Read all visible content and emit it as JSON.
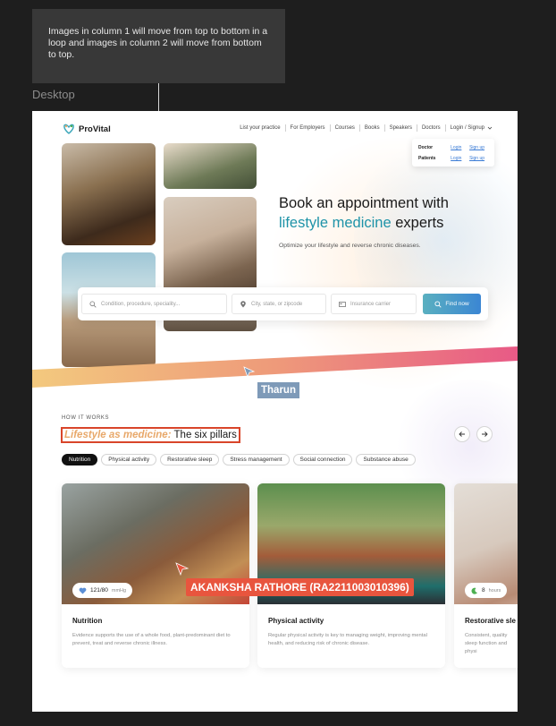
{
  "annotation": {
    "note": "Images in column 1 will move from top to bottom in a loop and images in column 2 will move from bottom to top.",
    "frame_label": "Desktop"
  },
  "nav": {
    "logo": "ProVital",
    "links": [
      "List your practice",
      "For Employers",
      "Courses",
      "Books",
      "Speakers",
      "Doctors",
      "Login / Signup"
    ]
  },
  "login_dropdown": {
    "rows": [
      {
        "role": "Doctor",
        "login": "Login",
        "signup": "Sign up"
      },
      {
        "role": "Patients",
        "login": "Login",
        "signup": "Sign up"
      }
    ]
  },
  "hero": {
    "title_line1": "Book an appointment with",
    "title_accent": "lifestyle medicine",
    "title_rest": " experts",
    "subtitle": "Optimize your lifestyle and reverse chronic diseases."
  },
  "search": {
    "condition_placeholder": "Condition, procedure, speciality...",
    "location_placeholder": "City, state, or zipcode",
    "insurance_placeholder": "Insurance carrier",
    "button": "Find now"
  },
  "cursors": {
    "tharun": "Tharun",
    "akanksha": "AKANKSHA RATHORE (RA2211003010396)"
  },
  "how_it_works": {
    "label": "HOW IT WORKS",
    "title_accent": "Lifestyle as medicine:",
    "title_rest": " The six pillars",
    "chips": [
      "Nutrition",
      "Physical activity",
      "Restorative sleep",
      "Stress management",
      "Social connection",
      "Substance abuse"
    ],
    "active_chip": "Nutrition"
  },
  "cards": [
    {
      "title": "Nutrition",
      "badge_value": "121/80",
      "badge_unit": "mmHg",
      "text": "Evidence supports the use of a whole food, plant-predominant diet to prevent, treat and reverse chronic illness."
    },
    {
      "title": "Physical activity",
      "text": "Regular physical activity is key to managing weight, improving mental health, and reducing risk of chronic disease."
    },
    {
      "title": "Restorative sle",
      "badge_value": "8",
      "badge_unit": "hours",
      "text": "Consistent, quality sleep function and physi"
    }
  ],
  "colors": {
    "accent_teal": "#1e93a8",
    "accent_orange": "#e8a86a",
    "highlight_red": "#d9452a",
    "button_gradient_start": "#5ab0c0",
    "button_gradient_end": "#3b86d3"
  }
}
